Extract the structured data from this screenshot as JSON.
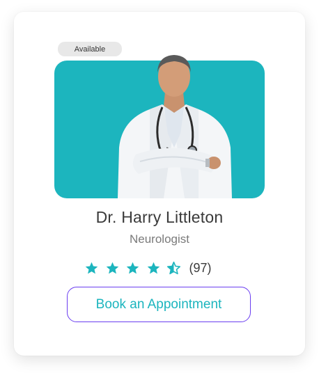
{
  "card": {
    "badge": "Available",
    "doctor_name": "Dr. Harry Littleton",
    "specialty": "Neurologist",
    "rating": {
      "stars": 4.5,
      "max_stars": 5,
      "count_text": "(97)"
    },
    "button_label": "Book an Appointment"
  },
  "colors": {
    "accent": "#1cb5be",
    "button_border": "#6a3df0",
    "badge_bg": "#e8e8e8"
  },
  "icons": [
    "star-icon",
    "half-star-icon"
  ]
}
